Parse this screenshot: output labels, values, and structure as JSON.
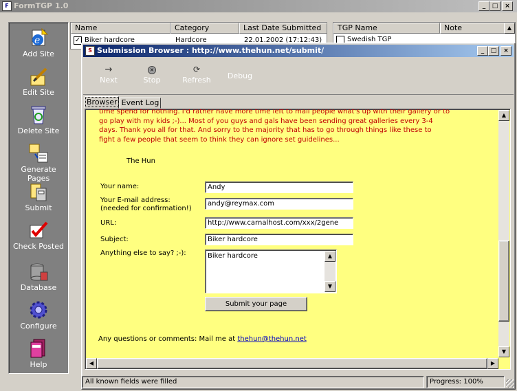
{
  "main_window": {
    "title": "FormTGP 1.0"
  },
  "sidebar": {
    "items": [
      {
        "label": "Add Site",
        "icon": "add-site-icon"
      },
      {
        "label": "Edit Site",
        "icon": "edit-site-icon"
      },
      {
        "label": "Delete Site",
        "icon": "recycle-bin-icon"
      },
      {
        "label": "Generate Pages",
        "icon": "generate-pages-icon"
      },
      {
        "label": "Submit",
        "icon": "submit-icon"
      },
      {
        "label": "Check Posted",
        "icon": "check-posted-icon"
      },
      {
        "label": "Database",
        "icon": "database-icon"
      },
      {
        "label": "Configure",
        "icon": "gear-icon"
      },
      {
        "label": "Help",
        "icon": "help-book-icon"
      }
    ]
  },
  "sites_table": {
    "columns": [
      "Name",
      "Category",
      "Last Date Submitted"
    ],
    "rows": [
      {
        "name": "Biker hardcore",
        "category": "Hardcore",
        "date": "22.01.2002 (17:12:43)"
      }
    ]
  },
  "tgp_table": {
    "columns": [
      "TGP Name",
      "Note"
    ],
    "rows": [
      {
        "name": "Swedish TGP"
      }
    ]
  },
  "dialog": {
    "title": "Submission Browser : http://www.thehun.net/submit/",
    "toolbar": {
      "next": "Next",
      "stop": "Stop",
      "refresh": "Refresh",
      "debug": "Debug"
    },
    "tabs": [
      "Browser",
      "Event Log"
    ],
    "page": {
      "intro_lines": [
        "time spend for nothing. I'd rather have more time left to mail people what's up with their gallery or to",
        "go play with my kids ;-)... Most of you guys and gals have been sending great galleries every 3-4",
        "days. Thank you all for that. And sorry to the majority that has to go through things like these to",
        "fight a few people that seem to think they can ignore set guidelines..."
      ],
      "signature": "The Hun",
      "fields": {
        "name_label": "Your name:",
        "name_value": "Andy",
        "email_label": "Your E-mail address:",
        "email_label2": "(needed for confirmation!)",
        "email_value": "andy@reymax.com",
        "url_label": "URL:",
        "url_value": "http://www.carnalhost.com/xxx/2gene",
        "subject_label": "Subject:",
        "subject_value": "Biker hardcore",
        "comments_label": "Anything else to say? ;-):",
        "comments_value": "Biker hardcore"
      },
      "submit_button": "Submit your page",
      "contact_text": "Any questions or comments: Mail me at",
      "contact_link": "thehun@thehun.net"
    },
    "status": {
      "message": "All known fields were filled",
      "progress": "Progress: 100%"
    }
  },
  "colors": {
    "accent": "#0a246a",
    "page_bg": "#ffff80",
    "intro_text": "#c00000",
    "sidebar_bg": "#808080"
  }
}
